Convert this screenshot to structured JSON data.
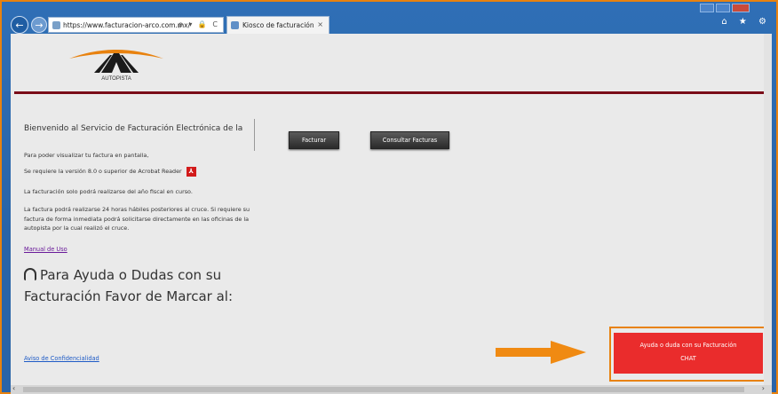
{
  "browser": {
    "url": "https://www.facturacion-arco.com.mx/",
    "address_tools": "ρ ▾ 🔒 C",
    "tab_title": "Kiosco de facturación",
    "tab_close": "×",
    "right_icons": "⌂ ★ ⚙"
  },
  "logo": {
    "text": "AUTOPISTA"
  },
  "content": {
    "welcome": "Bienvenido al Servicio de Facturación Electrónica de la",
    "p1": "Para poder visualizar tu factura en pantalla,",
    "p2": "Se requiere la versión 8.0 o superior de Acrobat Reader",
    "p3": "La facturación solo podrá realizarse del año fiscal en curso.",
    "p4": "La factura podrá realizarse 24 horas hábiles posteriores al cruce. Si requiere su factura de forma inmediata podrá solicitarse directamente en las oficinas de la autopista por la cual realizó el cruce.",
    "manual_link": "Manual de Uso",
    "help_line1": "Para Ayuda o Dudas con su",
    "help_line2": "Facturación Favor de Marcar al:",
    "aviso_link": "Aviso de Confidencialidad"
  },
  "buttons": {
    "facturar": "Facturar",
    "consultar": "Consultar Facturas"
  },
  "chat": {
    "line1": "Ayuda o duda con su Facturación",
    "line2": "CHAT"
  },
  "colors": {
    "accent_orange": "#e8820f",
    "chat_red": "#ea2c2c",
    "divider_red": "#7a0c18"
  }
}
